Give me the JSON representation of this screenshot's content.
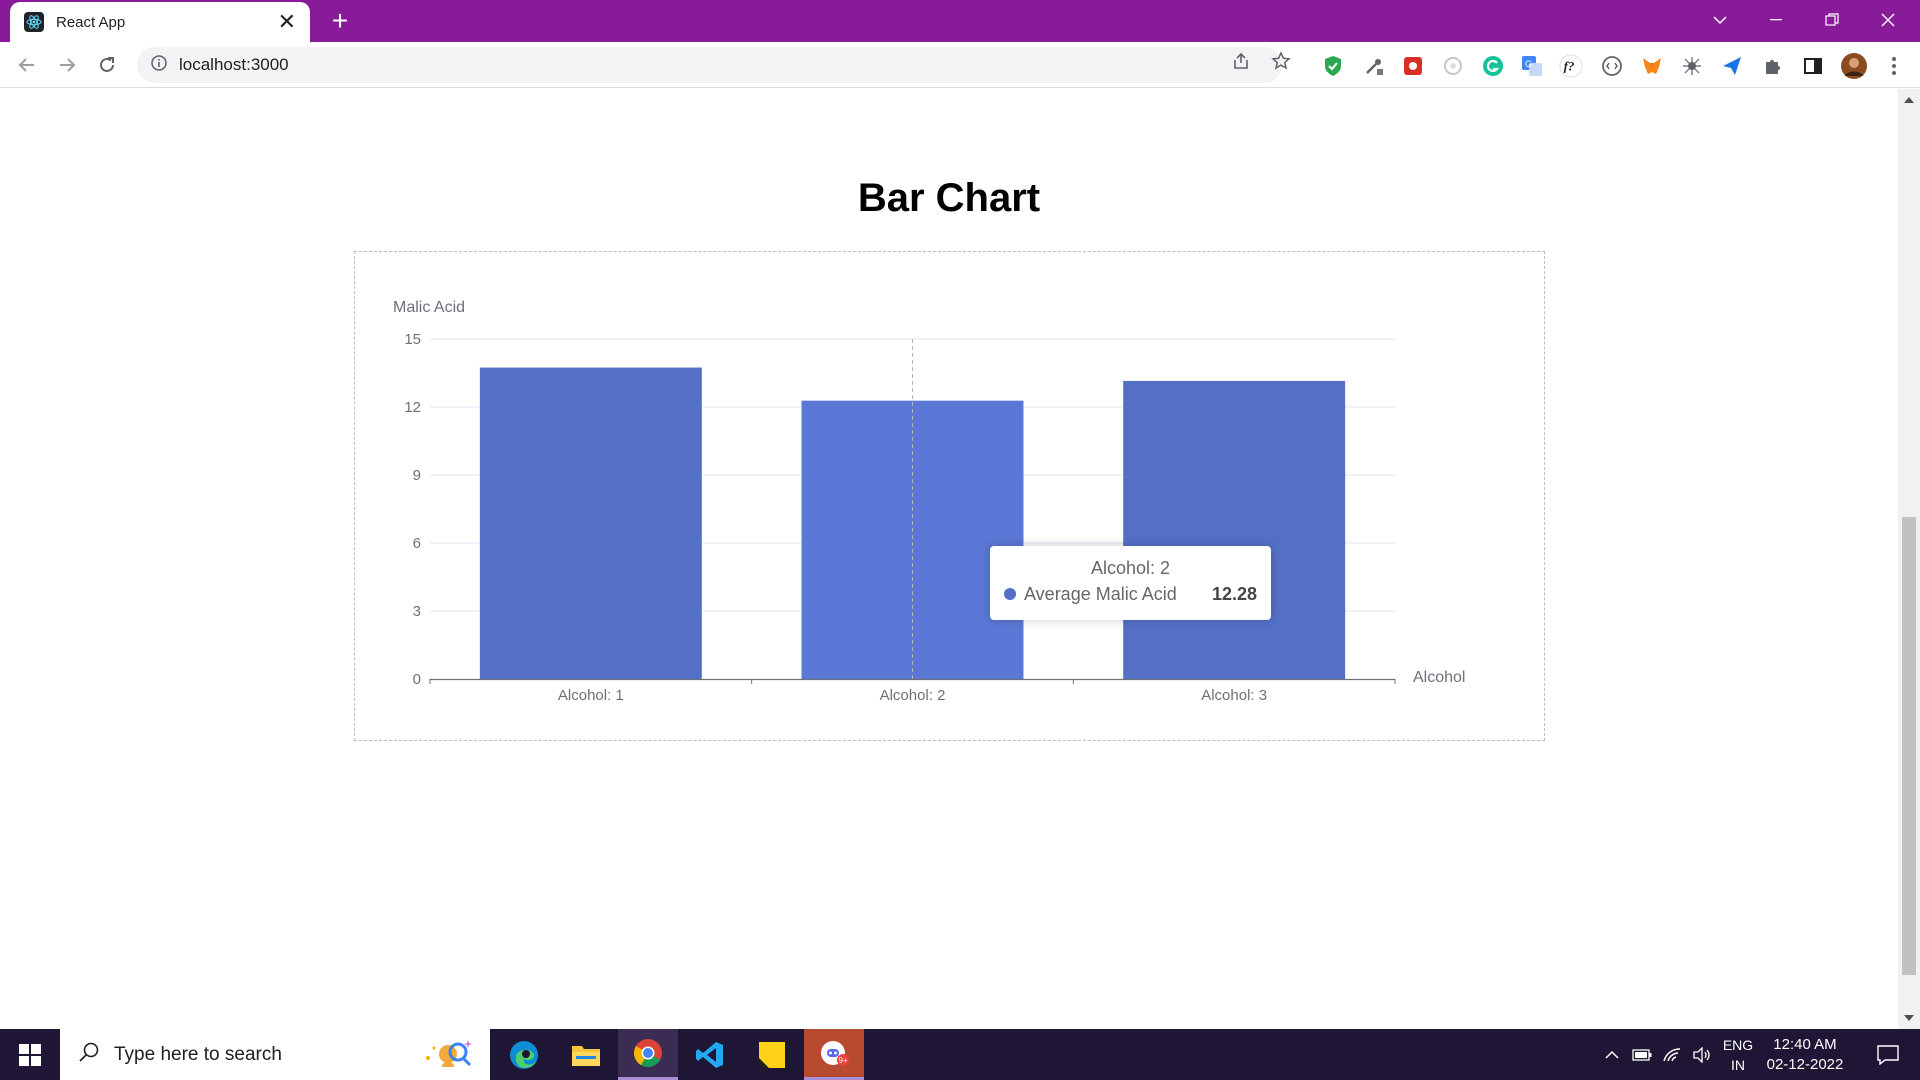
{
  "browser": {
    "tab_title": "React App",
    "tab_close": "✕",
    "new_tab": "+",
    "url": "localhost:3000",
    "theme_color": "#891a99"
  },
  "page": {
    "title": "Bar Chart"
  },
  "chart_data": {
    "type": "bar",
    "categories": [
      "Alcohol: 1",
      "Alcohol: 2",
      "Alcohol: 3"
    ],
    "series": [
      {
        "name": "Average Malic Acid",
        "values": [
          13.74,
          12.28,
          13.15
        ],
        "color": "#5470c6"
      }
    ],
    "xlabel": "Alcohol",
    "ylabel": "Malic Acid",
    "ylim": [
      0,
      15
    ],
    "yticks": [
      "0",
      "3",
      "6",
      "9",
      "12",
      "15"
    ],
    "grid": true,
    "highlighted_category": "Alcohol: 2"
  },
  "tooltip": {
    "title": "Alcohol: 2",
    "series_name": "Average Malic Acid",
    "value": "12.28"
  },
  "taskbar": {
    "search_placeholder": "Type here to search",
    "language": "ENG",
    "region": "IN",
    "time": "12:40 AM",
    "date": "02-12-2022"
  }
}
